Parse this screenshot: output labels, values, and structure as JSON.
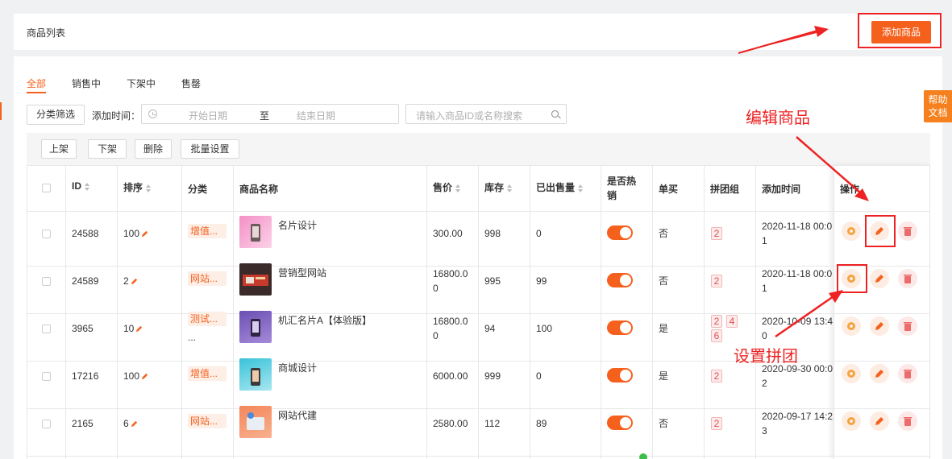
{
  "header": {
    "title": "商品列表",
    "add_button": "添加商品"
  },
  "tabs": [
    {
      "label": "全部",
      "active": true
    },
    {
      "label": "销售中",
      "active": false
    },
    {
      "label": "下架中",
      "active": false
    },
    {
      "label": "售罄",
      "active": false
    }
  ],
  "filters": {
    "category_button": "分类筛选",
    "date_label": "添加时间：",
    "start_placeholder": "开始日期",
    "separator": "至",
    "end_placeholder": "结束日期",
    "search_placeholder": "请输入商品ID或名称搜索"
  },
  "toolbar": {
    "list_on": "上架",
    "list_off": "下架",
    "delete": "删除",
    "batch": "批量设置"
  },
  "columns": {
    "id": "ID",
    "sort": "排序",
    "category": "分类",
    "name": "商品名称",
    "price": "售价",
    "stock": "库存",
    "sold": "已出售量",
    "hot_1": "是否热",
    "hot_2": "销",
    "single": "单买",
    "group": "拼团组",
    "added": "添加时间",
    "ops": "操作"
  },
  "rows": [
    {
      "id": "24588",
      "sort": "100",
      "category": "增值...",
      "category_2": "",
      "name": "名片设计",
      "price_1": "300.00",
      "price_2": "",
      "stock": "998",
      "sold": "0",
      "single": "否",
      "groups": [
        "2"
      ],
      "added_1": "2020-11-18 00:0",
      "added_2": "1"
    },
    {
      "id": "24589",
      "sort": "2",
      "category": "网站...",
      "category_2": "",
      "name": "营销型网站",
      "price_1": "16800.0",
      "price_2": "0",
      "stock": "995",
      "sold": "99",
      "single": "否",
      "groups": [
        "2"
      ],
      "added_1": "2020-11-18 00:0",
      "added_2": "1"
    },
    {
      "id": "3965",
      "sort": "10",
      "category": "测试...",
      "category_2": "...",
      "name": "机汇名片A【体验版】",
      "price_1": "16800.0",
      "price_2": "0",
      "stock": "94",
      "sold": "100",
      "single": "是",
      "groups": [
        "2",
        "4",
        "6"
      ],
      "added_1": "2020-10-09 13:4",
      "added_2": "0"
    },
    {
      "id": "17216",
      "sort": "100",
      "category": "增值...",
      "category_2": "",
      "name": "商城设计",
      "price_1": "6000.00",
      "price_2": "",
      "stock": "999",
      "sold": "0",
      "single": "是",
      "groups": [
        "2"
      ],
      "added_1": "2020-09-30 00:0",
      "added_2": "2"
    },
    {
      "id": "2165",
      "sort": "6",
      "category": "网站...",
      "category_2": "",
      "name": "网站代建",
      "price_1": "2580.00",
      "price_2": "",
      "stock": "112",
      "sold": "89",
      "single": "否",
      "groups": [
        "2"
      ],
      "added_1": "2020-09-17 14:2",
      "added_2": "3"
    }
  ],
  "help_tab": {
    "line1": "帮助",
    "line2": "文档"
  },
  "annotations": {
    "edit": "编辑商品",
    "group": "设置拼团"
  },
  "colors": {
    "accent": "#f5611d",
    "annotation": "#ee2222",
    "group_tag": "#e34d4d"
  },
  "icons": {
    "gear": "gear-icon",
    "edit": "pencil-icon",
    "delete": "trash-icon",
    "sort": "sort-caret-icon",
    "clock": "clock-icon",
    "search": "search-icon"
  }
}
